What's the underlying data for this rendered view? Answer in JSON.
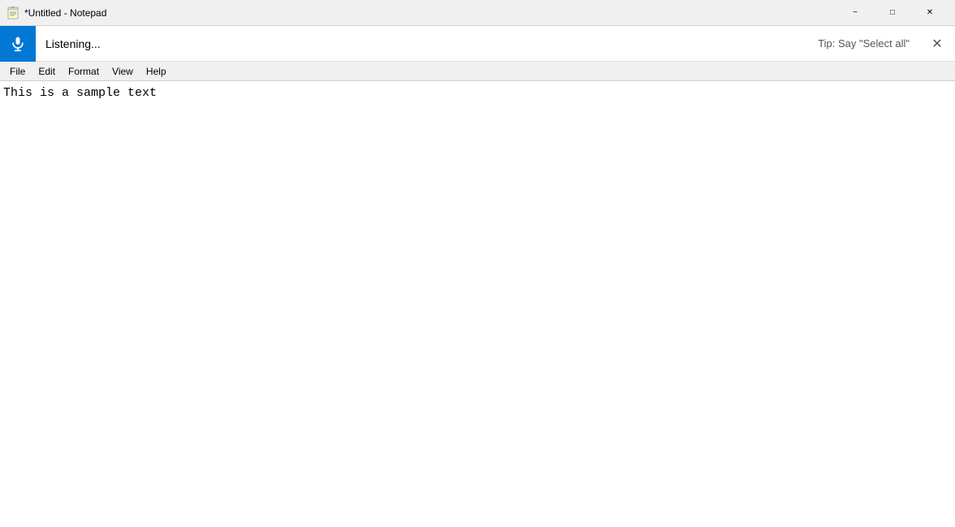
{
  "titleBar": {
    "title": "*Untitled - Notepad",
    "iconAlt": "Notepad icon",
    "minimizeLabel": "−",
    "maximizeLabel": "□",
    "closeLabel": "✕"
  },
  "dictationBar": {
    "status": "Listening...",
    "tip": "Tip: Say \"Select all\"",
    "closeLabel": "✕"
  },
  "menuBar": {
    "items": [
      {
        "label": "File"
      },
      {
        "label": "Edit"
      },
      {
        "label": "Format"
      },
      {
        "label": "View"
      },
      {
        "label": "Help"
      }
    ]
  },
  "editor": {
    "content": "This is a sample text"
  }
}
